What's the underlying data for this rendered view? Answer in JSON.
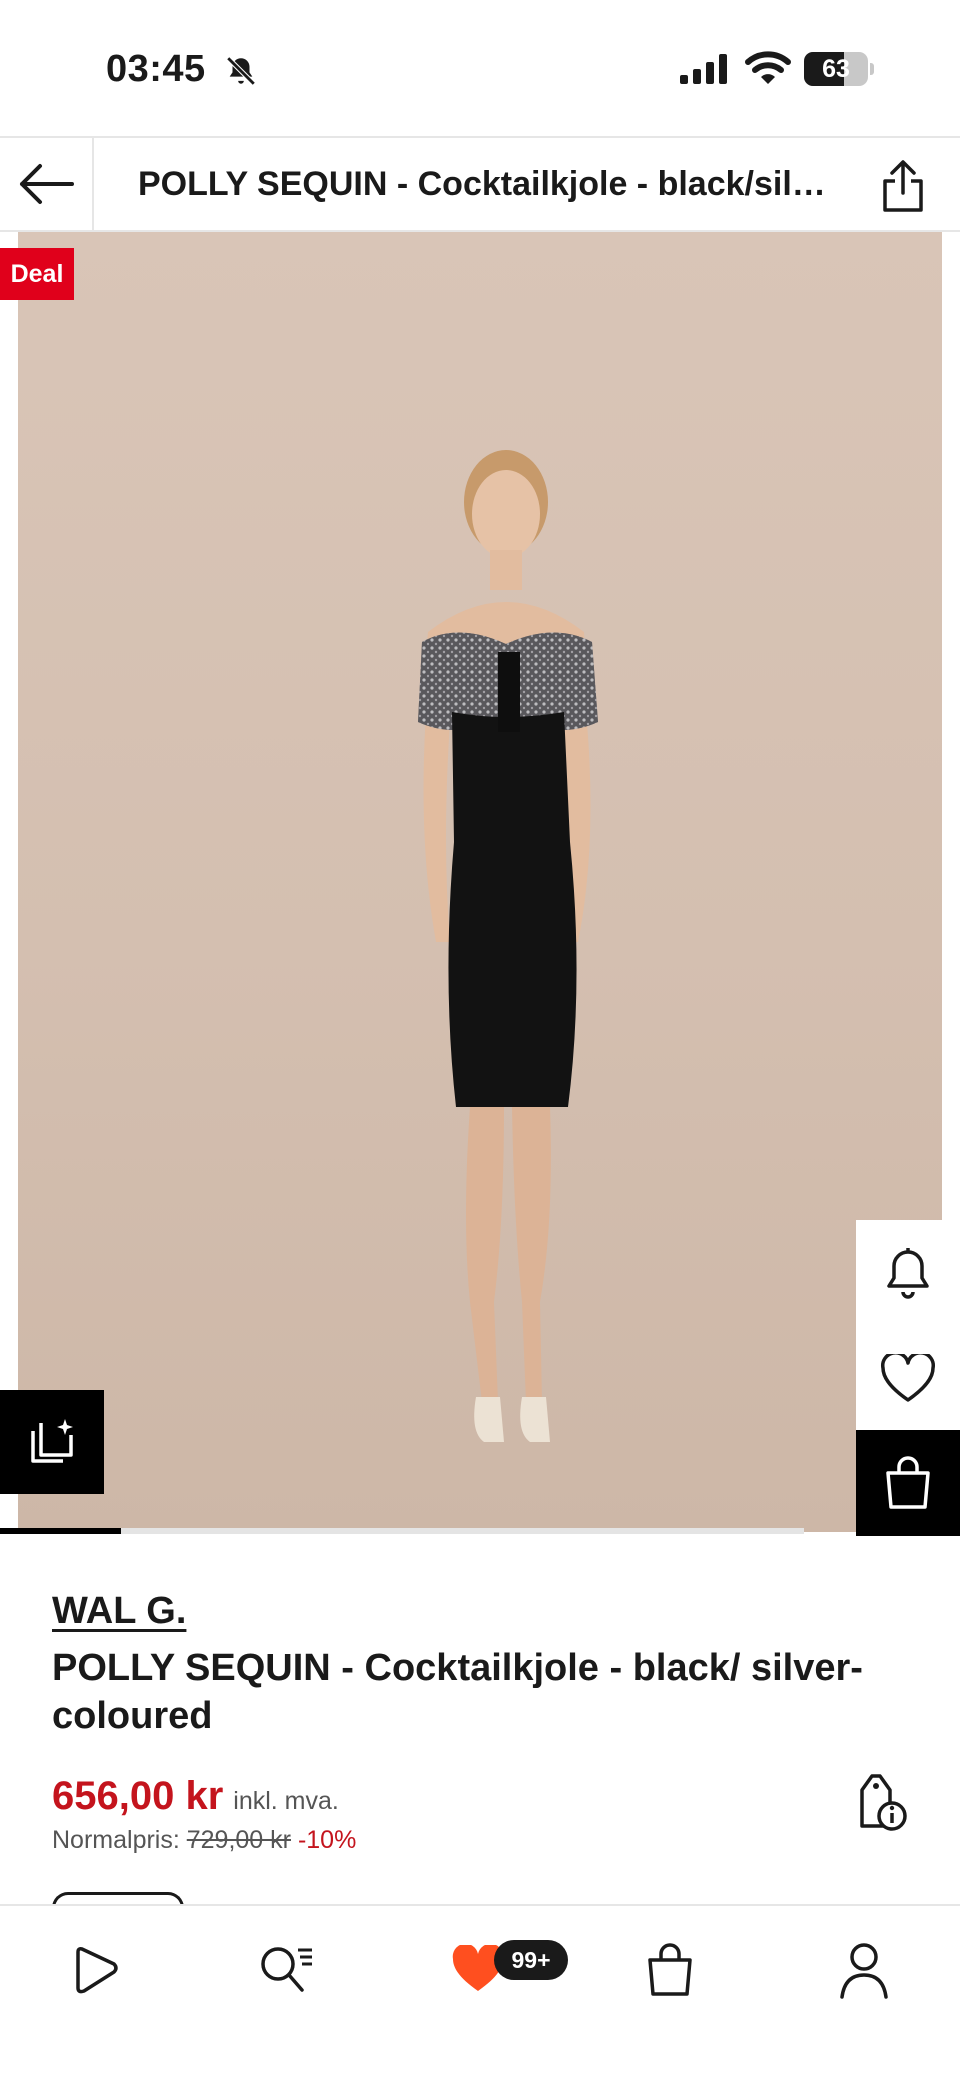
{
  "status_bar": {
    "time": "03:45",
    "battery": "63",
    "battery_level": 0.63,
    "icons": [
      "bell-muted-icon",
      "signal-icon",
      "wifi-icon",
      "battery-icon"
    ]
  },
  "top_nav": {
    "title": "POLLY SEQUIN - Cocktailkjole - black/silver-coloured",
    "back_icon": "arrow-left-icon",
    "share_icon": "share-icon"
  },
  "gallery": {
    "badge": "Deal",
    "progress": 0.15,
    "similar_icon": "similar-items-icon",
    "side_actions": [
      "bell-icon",
      "heart-icon",
      "shopping-bag-icon"
    ]
  },
  "product": {
    "brand": "WAL G.",
    "name": "POLLY SEQUIN - Cocktailkjole - black/ silver-coloured",
    "price": "656,00 kr",
    "vat_note": "inkl. mva.",
    "normal_label": "Normalpris:",
    "old_price": "729,00 kr",
    "discount": "-10%",
    "price_info_icon": "price-tag-info-icon"
  },
  "tab_bar": {
    "tabs": [
      "home-icon",
      "search-icon",
      "wishlist-icon",
      "bag-icon",
      "account-icon"
    ],
    "wishlist_badge": "99+"
  },
  "colors": {
    "sale_red": "#c4141d",
    "deal_red": "#e0001b",
    "wishlist_orange": "#ff4f1f",
    "backdrop": "#d6c2b4"
  }
}
